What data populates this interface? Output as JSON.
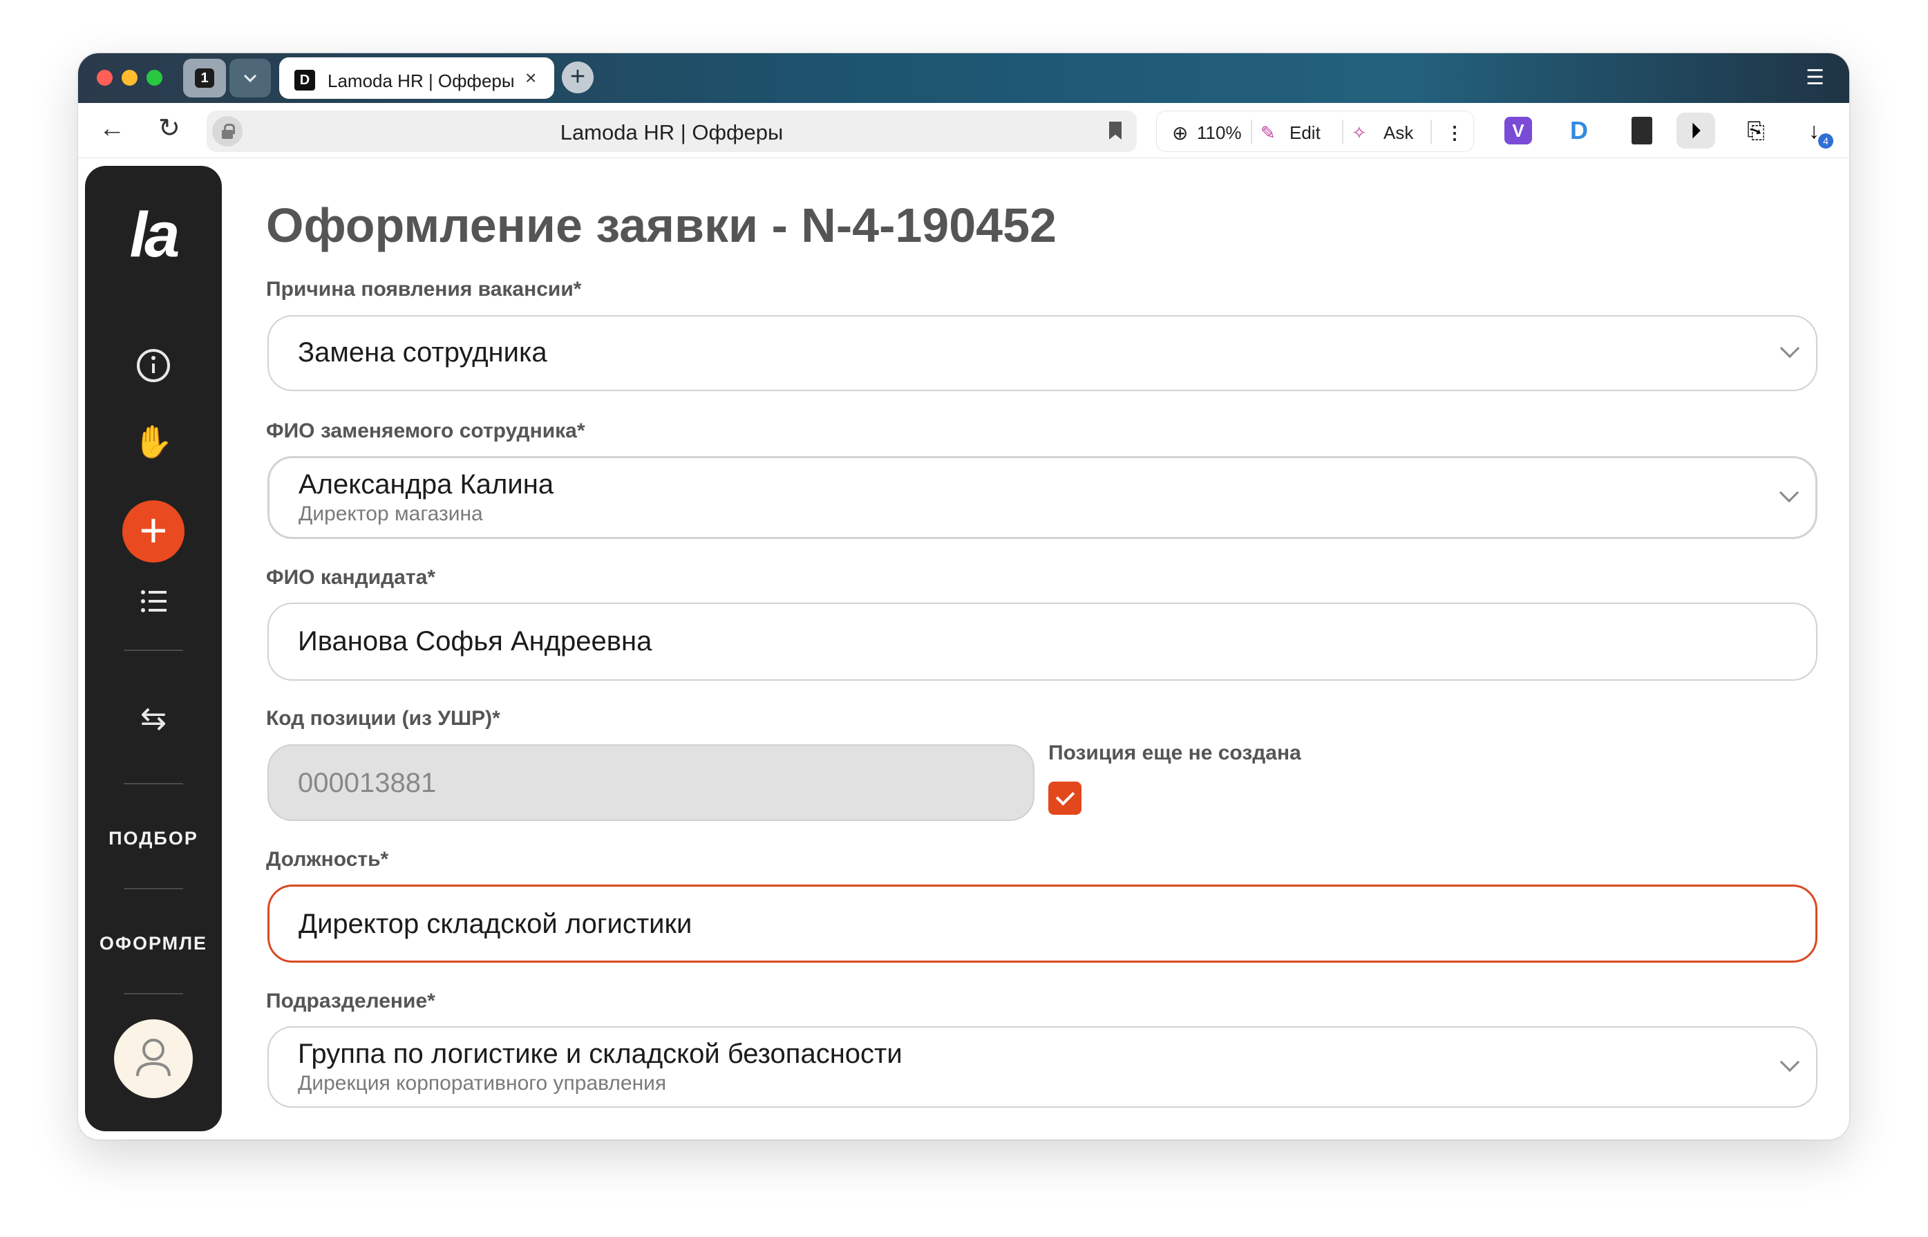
{
  "browser": {
    "tab_count": "1",
    "tab_title": "Lamoda HR | Офферы",
    "url_text": "Lamoda HR | Офферы",
    "zoom": "110%",
    "edit_label": "Edit",
    "ask_label": "Ask",
    "downloads_badge": "4",
    "colors": {
      "accent": "#ea4a1f",
      "sidebar": "#212121",
      "tabbar": "#1d5470"
    }
  },
  "sidebar": {
    "logo": "la",
    "nav_podbor": "ПОДБОР",
    "nav_oformle": "ОФОРМЛЕ"
  },
  "page": {
    "title": "Оформление заявки - N-4-190452",
    "reason": {
      "label": "Причина появления вакансии*",
      "value": "Замена сотрудника"
    },
    "replaced": {
      "label": "ФИО заменяемого сотрудника*",
      "value": "Александра Калина",
      "sub": "Директор магазина"
    },
    "candidate": {
      "label": "ФИО кандидата*",
      "value": "Иванова Софья Андреевна"
    },
    "position_code": {
      "label": "Код позиции (из УШР)*",
      "value": "000013881"
    },
    "not_created": {
      "label": "Позиция еще не создана",
      "checked": true
    },
    "job_title": {
      "label": "Должность*",
      "value": "Директор складской логистики"
    },
    "department": {
      "label": "Подразделение*",
      "value": "Группа по логистике и складской безопасности",
      "sub": "Дирекция корпоративного управления"
    }
  }
}
